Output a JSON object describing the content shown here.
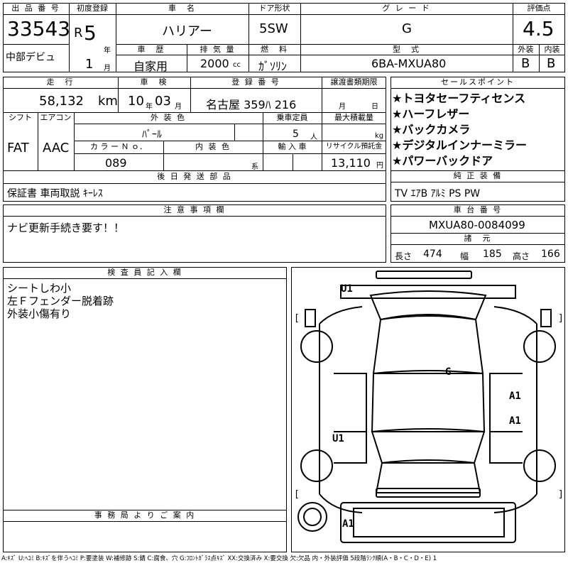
{
  "header": {
    "lot_no_label": "出 品 番 号",
    "lot_no": "33543",
    "venue": "中部デビュ",
    "first_reg_label": "初度登録",
    "era": "R",
    "year": "5",
    "year_unit": "年",
    "month": "1",
    "month_unit": "月",
    "car_name_label": "車　名",
    "car_name": "ハリアー",
    "door_label": "ドア形状",
    "door": "5SW",
    "grade_label": "グ レ ー ド",
    "grade": "G",
    "score_label": "評価点",
    "score": "4.5",
    "history_label": "車　歴",
    "history": "自家用",
    "disp_label": "排 気 量",
    "disp": "2000",
    "disp_unit": "cc",
    "fuel_label": "燃　料",
    "fuel": "ｶﾞｿﾘﾝ",
    "model_label": "型　式",
    "model": "6BA-MXUA80",
    "ext_label": "外装",
    "ext": "B",
    "int_label": "内装",
    "int": "B"
  },
  "row2": {
    "mileage_label": "走　行",
    "mileage": "58,132",
    "mileage_unit": "km",
    "inspect_label": "車　検",
    "inspect_y": "10",
    "inspect_y_unit": "年",
    "inspect_m": "03",
    "inspect_m_unit": "月",
    "plate_label": "登 録 番 号",
    "plate": "名古屋 359ﾊ 216",
    "transfer_label": "譲渡書類期限",
    "transfer_m_unit": "月",
    "transfer_d_unit": "日",
    "shift_label": "シフト",
    "shift": "FAT",
    "ac_label": "エアコン",
    "ac": "AAC",
    "ext_color_label": "外 装 色",
    "ext_color": "ﾊﾟｰﾙ",
    "capacity_label": "乗車定員",
    "capacity": "5",
    "capacity_unit": "人",
    "load_label": "最大積載量",
    "load_unit": "kg",
    "color_no_label": "カ ラ ー Ｎ ｏ．",
    "color_no": "089",
    "int_color_label": "内 装 色",
    "int_color_unit": "系",
    "import_label": "輸 入 車",
    "recycle_label": "リサイクル預託金",
    "recycle": "13,110",
    "recycle_unit": "円",
    "later_label": "後 日 発 送 部 品",
    "later": "保証書 車両取説 ｷｰﾚｽ"
  },
  "sales": {
    "label": "セールスポイント",
    "points": [
      "★トヨタセーフティセンス",
      "★ハーフレザー",
      "★バックカメラ",
      "★デジタルインナーミラー",
      "★パワーバックドア"
    ]
  },
  "equip": {
    "label": "純 正 装 備",
    "value": "TV ｴｱB ｱﾙﾐ PS PW"
  },
  "notes": {
    "label": "注 意 事 項 欄",
    "value": "ナビ更新手続き要す！！"
  },
  "chassis": {
    "label": "車 台 番 号",
    "value": "MXUA80-0084099",
    "dims_label": "諸　元",
    "len_label": "長さ",
    "len": "474",
    "wid_label": "幅",
    "wid": "185",
    "hei_label": "高さ",
    "hei": "166"
  },
  "inspector": {
    "label": "検 査 員 記 入 欄",
    "lines": [
      "シートしわ小",
      "左Ｆフェンダー脱着跡",
      "外装小傷有り"
    ]
  },
  "office": {
    "label": "事 務 局 よ り ご 案 内"
  },
  "diagram": {
    "marks": [
      {
        "id": "u1-top",
        "text": "U1"
      },
      {
        "id": "g",
        "text": "G"
      },
      {
        "id": "a1-right-front",
        "text": "A1"
      },
      {
        "id": "a1-right-rear",
        "text": "A1"
      },
      {
        "id": "u1-left",
        "text": "U1"
      },
      {
        "id": "a1-bottom",
        "text": "A1"
      }
    ]
  },
  "legend": "A:ｷｽﾞ U:ﾍｺﾐ B:ｷｽﾞを伴うﾍｺﾐ P:要塗装 W:補修跡 S:錆 C:腐食、穴 G:ﾌﾛﾝﾄｶﾞﾗｽ点ｷｽﾞ XX:交換済み X:要交換 欠:欠品 内・外装評価 5段階ﾗﾝｸ順(A・B・C・D・E) 1"
}
